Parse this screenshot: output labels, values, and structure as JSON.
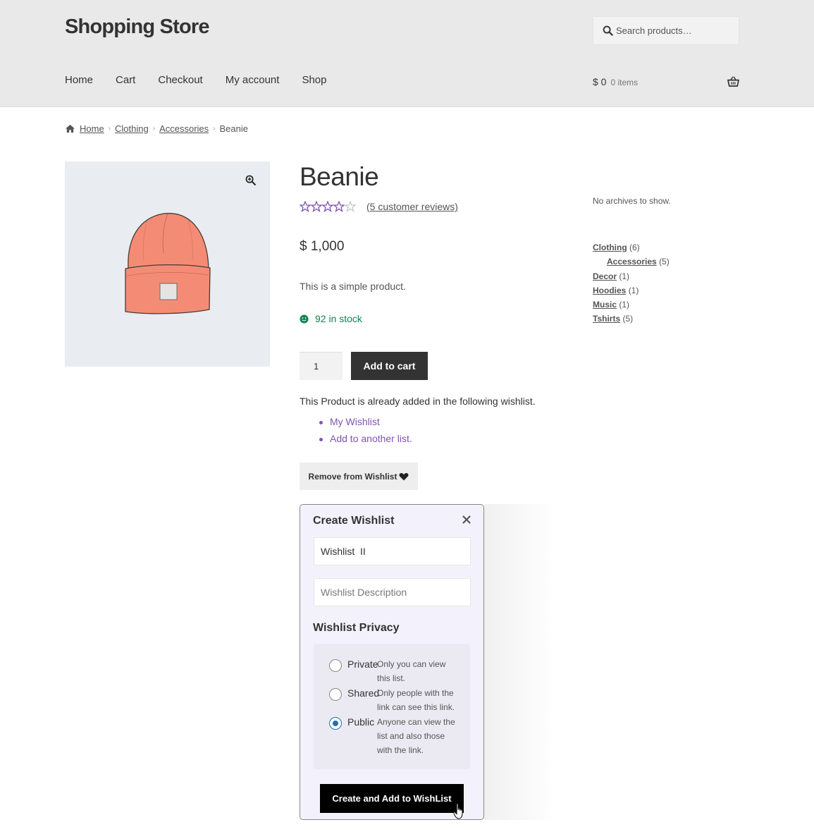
{
  "header": {
    "site_title": "Shopping Store",
    "search_placeholder": "Search products…",
    "nav": [
      "Home",
      "Cart",
      "Checkout",
      "My account",
      "Shop"
    ],
    "cart_total": "$ 0",
    "cart_count": "0 items"
  },
  "breadcrumb": [
    "Home",
    "Clothing",
    "Accessories",
    "Beanie"
  ],
  "product": {
    "title": "Beanie",
    "rating": 3.5,
    "rating_max": 5,
    "reviews": "(5 customer reviews)",
    "price": "$ 1,000",
    "short_description": "This is a simple product.",
    "stock": "92 in stock",
    "quantity": "1",
    "add_to_cart": "Add to cart",
    "image_bg": "#e9ecf0"
  },
  "wishlist": {
    "note": "This Product is already added in the following wishlist.",
    "links": [
      "My Wishlist",
      "Add to another list."
    ],
    "remove_button": "Remove from Wishlist"
  },
  "modal": {
    "title": "Create Wishlist",
    "name_value": "Wishlist  II",
    "description_placeholder": "Wishlist Description",
    "privacy_heading": "Wishlist Privacy",
    "options": [
      {
        "label": "Private",
        "description": "Only you can view this list.",
        "checked": false
      },
      {
        "label": "Shared",
        "description": "Only people with the link can see this link.",
        "checked": false
      },
      {
        "label": "Public",
        "description": "Anyone can view the list and also those with the link.",
        "checked": true
      }
    ],
    "create_button": "Create and Add to WishList"
  },
  "sidebar": {
    "no_archives": "No archives to show.",
    "categories": [
      {
        "name": "Clothing",
        "count": "(6)",
        "child": false
      },
      {
        "name": "Accessories",
        "count": "(5)",
        "child": true
      },
      {
        "name": "Decor",
        "count": "(1)",
        "child": false
      },
      {
        "name": "Hoodies",
        "count": "(1)",
        "child": false
      },
      {
        "name": "Music",
        "count": "(1)",
        "child": false
      },
      {
        "name": "Tshirts",
        "count": "(5)",
        "child": false
      }
    ]
  },
  "colors": {
    "header_bg": "#e9e9e9",
    "accent_purple": "#7f54b3",
    "stock_green": "#0f834d",
    "button_dark": "#333333",
    "radio_blue": "#2271b1"
  }
}
